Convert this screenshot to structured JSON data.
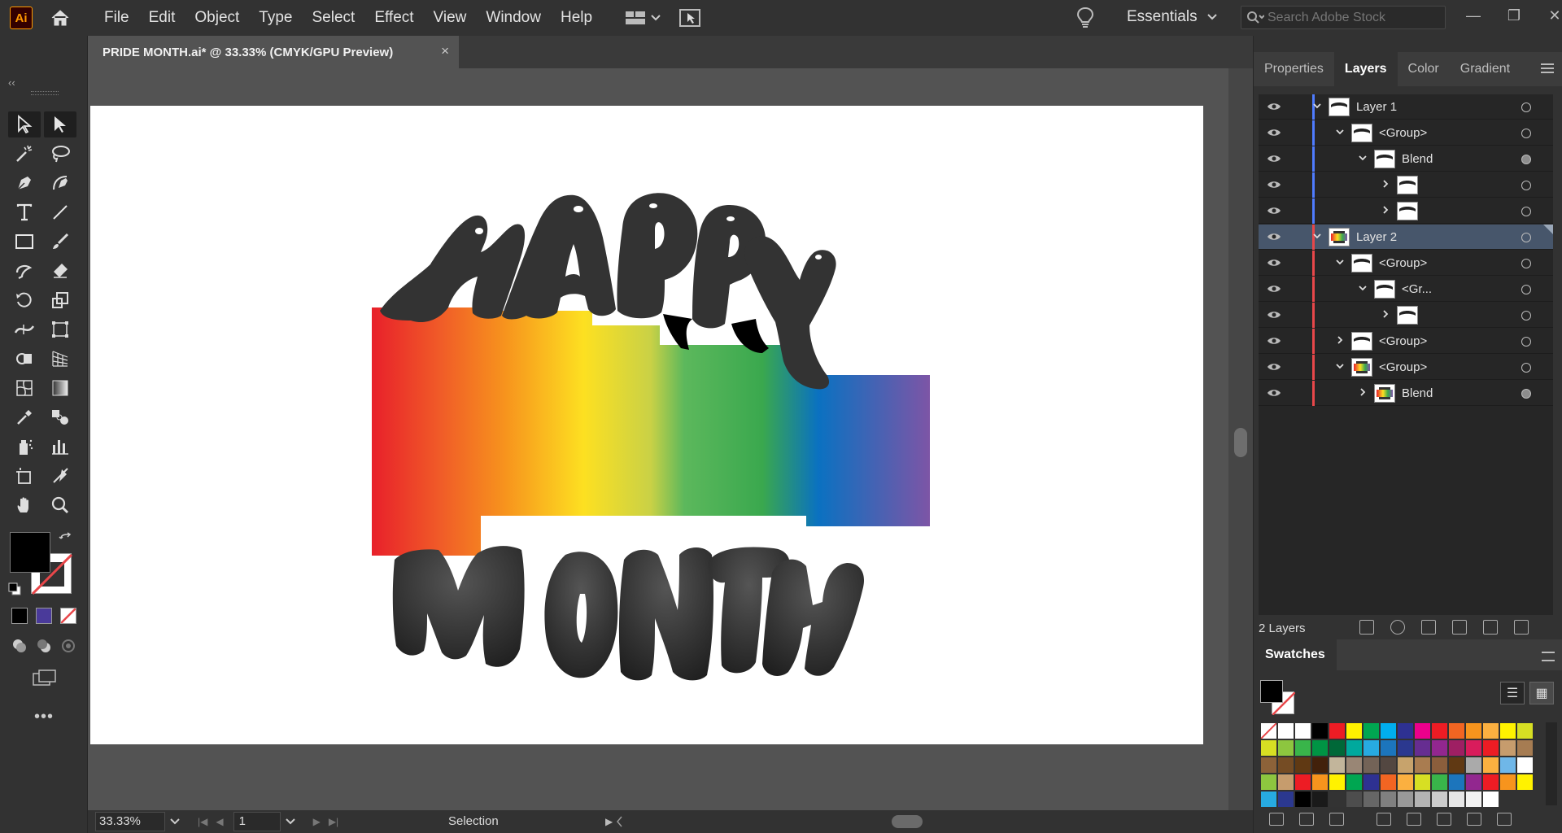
{
  "app": {
    "logo": "Ai",
    "menus": [
      "File",
      "Edit",
      "Object",
      "Type",
      "Select",
      "Effect",
      "View",
      "Window",
      "Help"
    ]
  },
  "workspace": {
    "label": "Essentials"
  },
  "search": {
    "placeholder": "Search Adobe Stock"
  },
  "document": {
    "tab_title": "PRIDE MONTH.ai* @ 33.33% (CMYK/GPU Preview)",
    "close": "×"
  },
  "status": {
    "zoom": "33.33%",
    "page": "1",
    "tool": "Selection"
  },
  "panel": {
    "tabs": [
      "Properties",
      "Layers",
      "Color",
      "Gradient"
    ],
    "active_tab": "Layers",
    "layers": [
      {
        "name": "Layer 1",
        "color": "#4f7cff",
        "level": 0,
        "expanded": true,
        "target_filled": false,
        "selected": false,
        "thumb": "happy"
      },
      {
        "name": "<Group>",
        "color": "#4f7cff",
        "level": 1,
        "expanded": true,
        "target_filled": false,
        "selected": false,
        "thumb": "happy"
      },
      {
        "name": "Blend",
        "color": "#4f7cff",
        "level": 2,
        "expanded": true,
        "target_filled": true,
        "selected": false,
        "thumb": "happy"
      },
      {
        "name": "",
        "color": "#4f7cff",
        "level": 3,
        "expanded": false,
        "target_filled": false,
        "selected": false,
        "thumb": "month"
      },
      {
        "name": "",
        "color": "#4f7cff",
        "level": 3,
        "expanded": false,
        "target_filled": false,
        "selected": false,
        "thumb": "month"
      },
      {
        "name": "Layer 2",
        "color": "#e8474a",
        "level": 0,
        "expanded": true,
        "target_filled": false,
        "selected": true,
        "thumb": "rainbow"
      },
      {
        "name": "<Group>",
        "color": "#e8474a",
        "level": 1,
        "expanded": true,
        "target_filled": false,
        "selected": false,
        "thumb": "happy"
      },
      {
        "name": "<Gr...",
        "color": "#e8474a",
        "level": 2,
        "expanded": true,
        "target_filled": false,
        "selected": false,
        "thumb": "happy"
      },
      {
        "name": "",
        "color": "#e8474a",
        "level": 3,
        "expanded": false,
        "target_filled": false,
        "selected": false,
        "thumb": "happy"
      },
      {
        "name": "<Group>",
        "color": "#e8474a",
        "level": 1,
        "expanded": false,
        "target_filled": false,
        "selected": false,
        "thumb": "happy"
      },
      {
        "name": "<Group>",
        "color": "#e8474a",
        "level": 1,
        "expanded": true,
        "target_filled": false,
        "selected": false,
        "thumb": "rainbow"
      },
      {
        "name": "Blend",
        "color": "#e8474a",
        "level": 2,
        "expanded": false,
        "target_filled": true,
        "selected": false,
        "thumb": "rainbow"
      }
    ],
    "layers_count": "2 Layers",
    "swatches_title": "Swatches"
  },
  "swatch_colors": [
    "#ffffff",
    "#ffffff",
    "#ffffff",
    "#000000",
    "#ed1c24",
    "#fff200",
    "#00a651",
    "#00aeef",
    "#2e3192",
    "#ec008c",
    "#ed1c24",
    "#f26522",
    "#f7941d",
    "#fbb040",
    "#fff200",
    "#d7df23",
    "#d7df23",
    "#8dc63f",
    "#39b54a",
    "#009444",
    "#006838",
    "#00a99d",
    "#27aae1",
    "#1c75bc",
    "#2b388f",
    "#662d91",
    "#92278f",
    "#9e1f63",
    "#d91c5c",
    "#ed1c24",
    "#c69c6d",
    "#a67c52",
    "#8c6239",
    "#754c24",
    "#603913",
    "#42210b",
    "#c2b59b",
    "#998675",
    "#736357",
    "#534741",
    "#c7a36c",
    "#a97c50",
    "#8b5e3c",
    "#603913",
    "#aaaaaa",
    "#fbb040",
    "#6fb7e8",
    "#ffffff",
    "#8dc63f",
    "#c69c6d",
    "#ed1c24",
    "#f7941d",
    "#fff200",
    "#00a651",
    "#2e3192",
    "#f26522",
    "#fbb040",
    "#d7df23",
    "#39b54a",
    "#1c75bc",
    "#92278f",
    "#ed1c24",
    "#f7941d",
    "#fff200",
    "#27aae1",
    "#2b388f",
    "#000000",
    "#1a1a1a",
    "#333333",
    "#4d4d4d",
    "#666666",
    "#808080",
    "#999999",
    "#b3b3b3",
    "#cccccc",
    "#e6e6e6",
    "#f2f2f2",
    "#ffffff"
  ]
}
